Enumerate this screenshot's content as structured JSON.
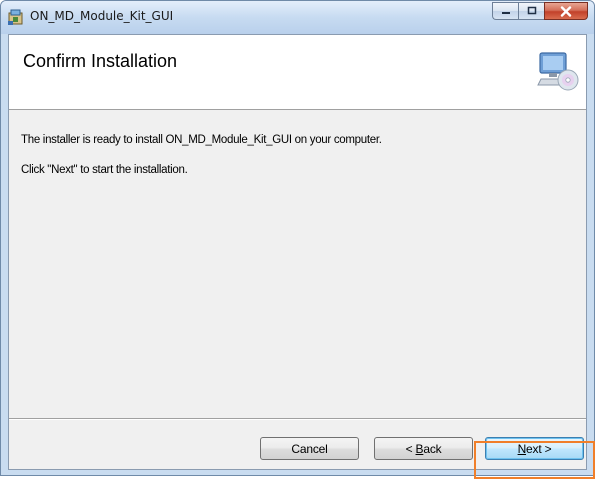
{
  "window": {
    "title": "ON_MD_Module_Kit_GUI",
    "icons": {
      "app": "installer-package-icon",
      "minimize": "minimize-icon",
      "maximize": "maximize-icon",
      "close": "close-icon",
      "banner": "computer-disc-icon"
    }
  },
  "banner": {
    "title": "Confirm Installation"
  },
  "body": {
    "line1": "The installer is ready to install ON_MD_Module_Kit_GUI on your computer.",
    "line2": "Click \"Next\" to start the installation."
  },
  "buttons": {
    "cancel": "Cancel",
    "back_prefix": "< ",
    "back_accel": "B",
    "back_rest": "ack",
    "next_accel": "N",
    "next_rest": "ext >"
  },
  "colors": {
    "highlight": "#f07f2a",
    "titlebar": "#c7dbf1",
    "close_button": "#c2412a"
  }
}
